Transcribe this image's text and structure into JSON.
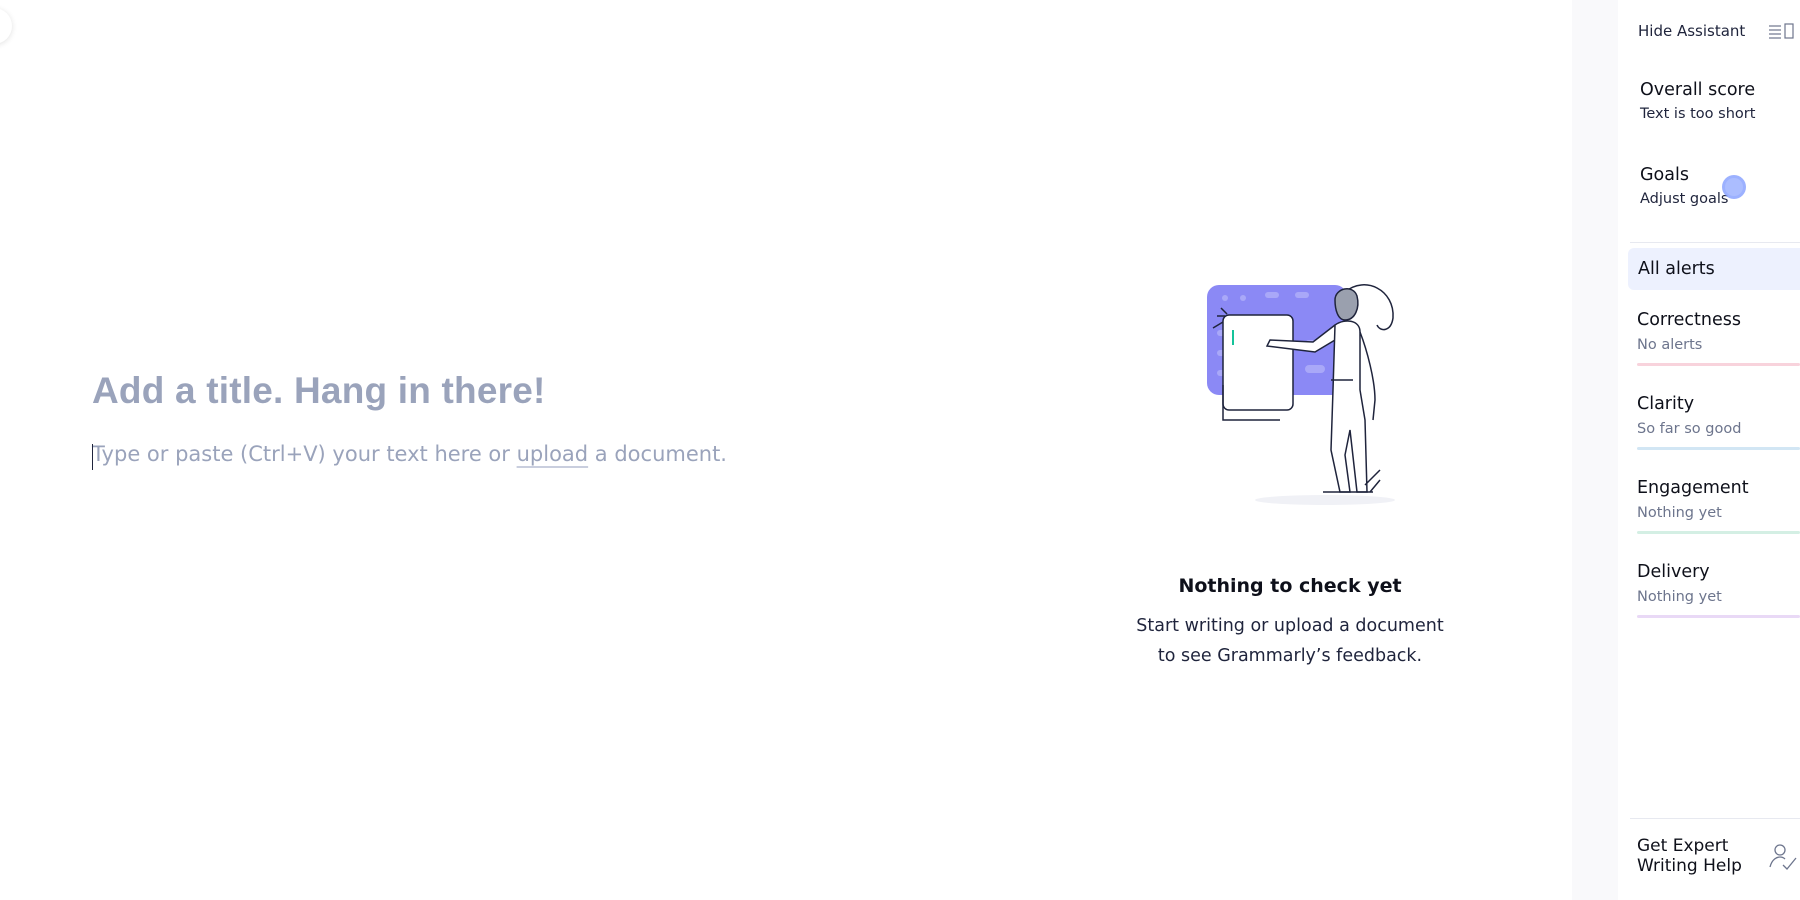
{
  "editor": {
    "title_placeholder": "Add a title. Hang in there!",
    "body_prefix": "Type or paste (Ctrl+V) your text here or ",
    "upload_link": "upload",
    "body_suffix": " a document."
  },
  "empty_state": {
    "title": "Nothing to check yet",
    "line1": "Start writing or upload a document",
    "line2": "to see Grammarly’s feedback."
  },
  "assistant": {
    "hide_label": "Hide Assistant",
    "overall_score": {
      "title": "Overall score",
      "status": "Text is too short"
    },
    "goals": {
      "title": "Goals",
      "link": "Adjust goals"
    },
    "all_alerts": "All alerts",
    "categories": [
      {
        "name": "Correctness",
        "status": "No alerts",
        "color": "#f8d3dc"
      },
      {
        "name": "Clarity",
        "status": "So far so good",
        "color": "#d2e6f4"
      },
      {
        "name": "Engagement",
        "status": "Nothing yet",
        "color": "#d4efe4"
      },
      {
        "name": "Delivery",
        "status": "Nothing yet",
        "color": "#e9d9f6"
      }
    ],
    "expert_help": {
      "line1": "Get Expert",
      "line2": "Writing Help"
    }
  },
  "colors": {
    "placeholder": "#9aa3bb",
    "accent_purple": "#8b89f5",
    "alerts_highlight": "#edf1fe",
    "caret_green": "#15c39a"
  },
  "icons": [
    "layout-toggle-icon",
    "expert-hand-icon"
  ]
}
